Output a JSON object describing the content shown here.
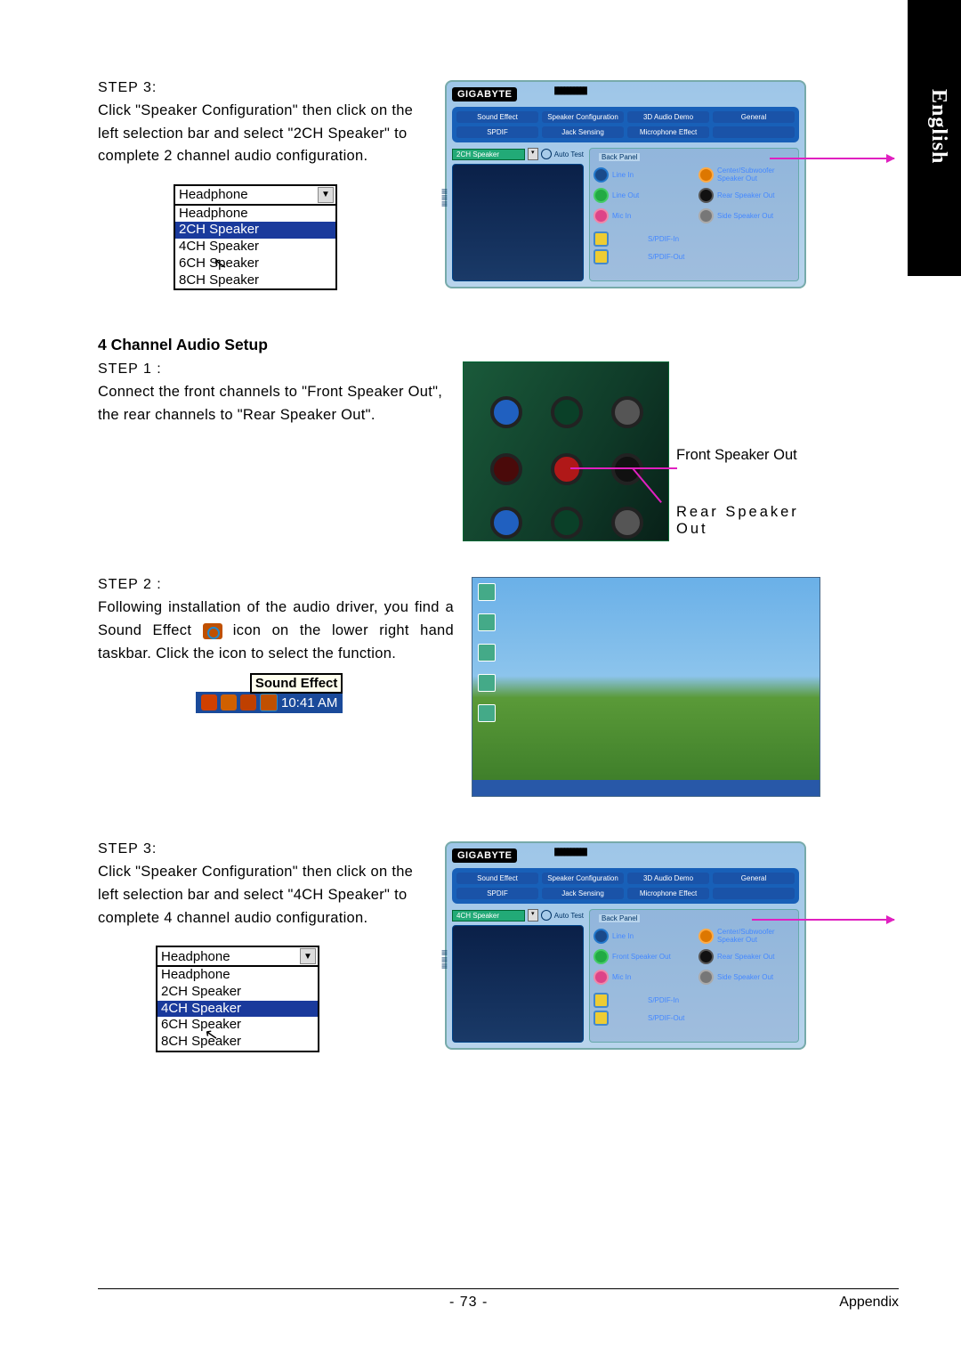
{
  "sidebar": {
    "language": "English"
  },
  "sec1": {
    "step": "STEP 3:",
    "text": "Click \"Speaker Configuration\" then click on the left selection bar and select \"2CH Speaker\" to complete 2 channel audio configuration.",
    "dropdown": {
      "selected": "Headphone",
      "options": [
        "Headphone",
        "2CH Speaker",
        "4CH Speaker",
        "6CH Speaker",
        "8CH Speaker"
      ],
      "highlight_index": 1
    }
  },
  "panel1": {
    "brand": "GIGABYTE",
    "tabs": [
      "Sound Effect",
      "Speaker Configuration",
      "3D Audio Demo",
      "General",
      "SPDIF",
      "Jack Sensing",
      "Microphone Effect",
      ""
    ],
    "selector": "2CH Speaker",
    "auto_test": "Auto Test",
    "back_panel_title": "Back Panel",
    "jacks_left": [
      {
        "cls": "blue",
        "label": "Line In"
      },
      {
        "cls": "grn",
        "label": "Line Out"
      },
      {
        "cls": "pnk",
        "label": "Mic In"
      }
    ],
    "jacks_right": [
      {
        "cls": "org",
        "label": "Center/Subwoofer Speaker Out"
      },
      {
        "cls": "blk",
        "label": "Rear Speaker Out"
      },
      {
        "cls": "gry",
        "label": "Side Speaker Out"
      }
    ],
    "spdif": [
      "S/PDIF-In",
      "S/PDIF-Out"
    ]
  },
  "sec2": {
    "heading": "4 Channel Audio Setup",
    "step": "STEP 1 :",
    "text": "Connect the front channels to \"Front Speaker Out\", the rear channels to \"Rear Speaker Out\".",
    "label_front": "Front Speaker Out",
    "label_rear": "Rear  Speaker Out"
  },
  "sec3": {
    "step": "STEP 2 :",
    "text_a": "Following installation of the audio driver, you find a Sound Effect ",
    "text_b": " icon on the lower right hand taskbar.  Click the icon to select the function.",
    "tooltip": "Sound Effect",
    "time": "10:41 AM"
  },
  "sec4": {
    "step": "STEP 3:",
    "text": "Click \"Speaker Configuration\" then click on the left selection bar and select \"4CH Speaker\" to complete 4 channel audio configuration.",
    "dropdown": {
      "selected": "Headphone",
      "options": [
        "Headphone",
        "2CH Speaker",
        "4CH Speaker",
        "6CH Speaker",
        "8CH Speaker"
      ],
      "highlight_index": 2
    }
  },
  "panel2": {
    "brand": "GIGABYTE",
    "tabs": [
      "Sound Effect",
      "Speaker Configuration",
      "3D Audio Demo",
      "General",
      "SPDIF",
      "Jack Sensing",
      "Microphone Effect",
      ""
    ],
    "selector": "4CH Speaker",
    "auto_test": "Auto Test",
    "back_panel_title": "Back Panel",
    "jacks_left": [
      {
        "cls": "blue",
        "label": "Line In"
      },
      {
        "cls": "grn",
        "label": "Front Speaker Out"
      },
      {
        "cls": "pnk",
        "label": "Mic In"
      }
    ],
    "jacks_right": [
      {
        "cls": "org",
        "label": "Center/Subwoofer Speaker Out"
      },
      {
        "cls": "blk",
        "label": "Rear Speaker Out"
      },
      {
        "cls": "gry",
        "label": "Side Speaker Out"
      }
    ],
    "spdif": [
      "S/PDIF-In",
      "S/PDIF-Out"
    ]
  },
  "footer": {
    "page": "- 73 -",
    "section": "Appendix"
  }
}
